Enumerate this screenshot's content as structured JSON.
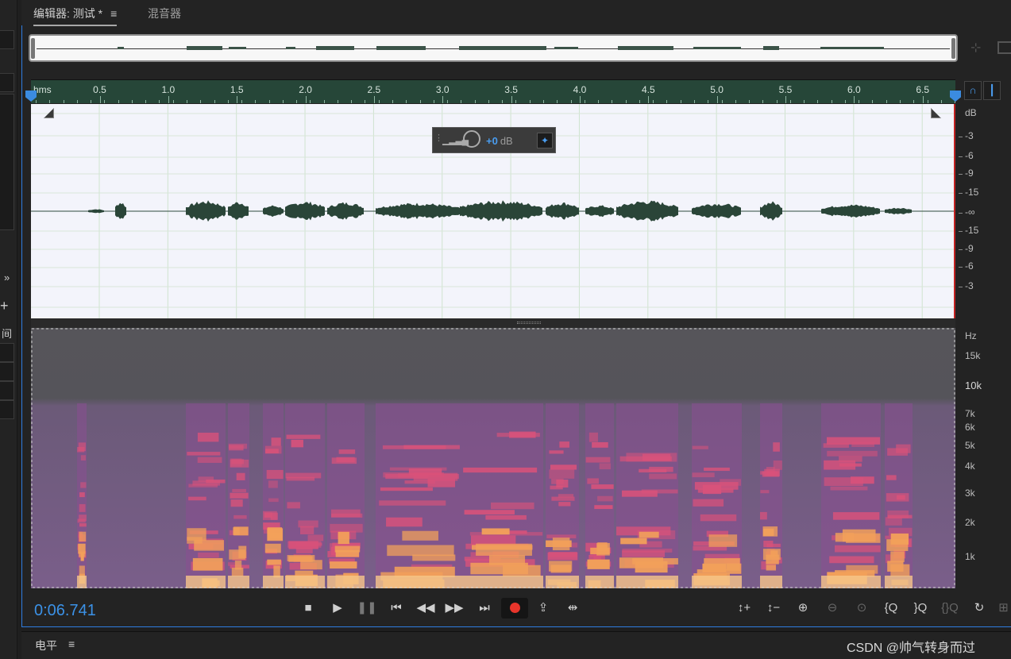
{
  "tabs": {
    "editor": "编辑器: 测试 *",
    "editor_menu": "≡",
    "mixer": "混音器"
  },
  "left_panel": {
    "label": "间",
    "expand": "»",
    "add": "+"
  },
  "ruler": {
    "unit": "hms",
    "marks": [
      "0.5",
      "1.0",
      "1.5",
      "2.0",
      "2.5",
      "3.0",
      "3.5",
      "4.0",
      "4.5",
      "5.0",
      "5.5",
      "6.0",
      "6.5"
    ]
  },
  "waveform": {
    "db_unit": "dB",
    "db_labels": [
      "-3",
      "-6",
      "-9",
      "-15",
      "-∞",
      "-15",
      "-9",
      "-6",
      "-3"
    ]
  },
  "hud": {
    "gain": "+0",
    "unit": "dB"
  },
  "spectrogram": {
    "hz_unit": "Hz",
    "hz_labels": [
      "15k",
      "10k",
      "7k",
      "6k",
      "5k",
      "4k",
      "3k",
      "2k",
      "1k"
    ]
  },
  "transport": {
    "current_time": "0:06.741",
    "buttons": [
      "stop",
      "play",
      "pause",
      "go-to-start",
      "rewind",
      "fast-forward",
      "go-to-end",
      "record",
      "loop",
      "skip-selection"
    ]
  },
  "zoom_buttons": [
    "zoom-in-amplitude",
    "zoom-out-amplitude",
    "zoom-in-time",
    "zoom-out-time",
    "zoom-selection",
    "zoom-in-left",
    "zoom-in-right",
    "zoom-out-full",
    "zoom-reset"
  ],
  "bottom": {
    "panel_title": "电平",
    "panel_menu": "≡"
  },
  "watermark": "CSDN @帅气转身而过"
}
